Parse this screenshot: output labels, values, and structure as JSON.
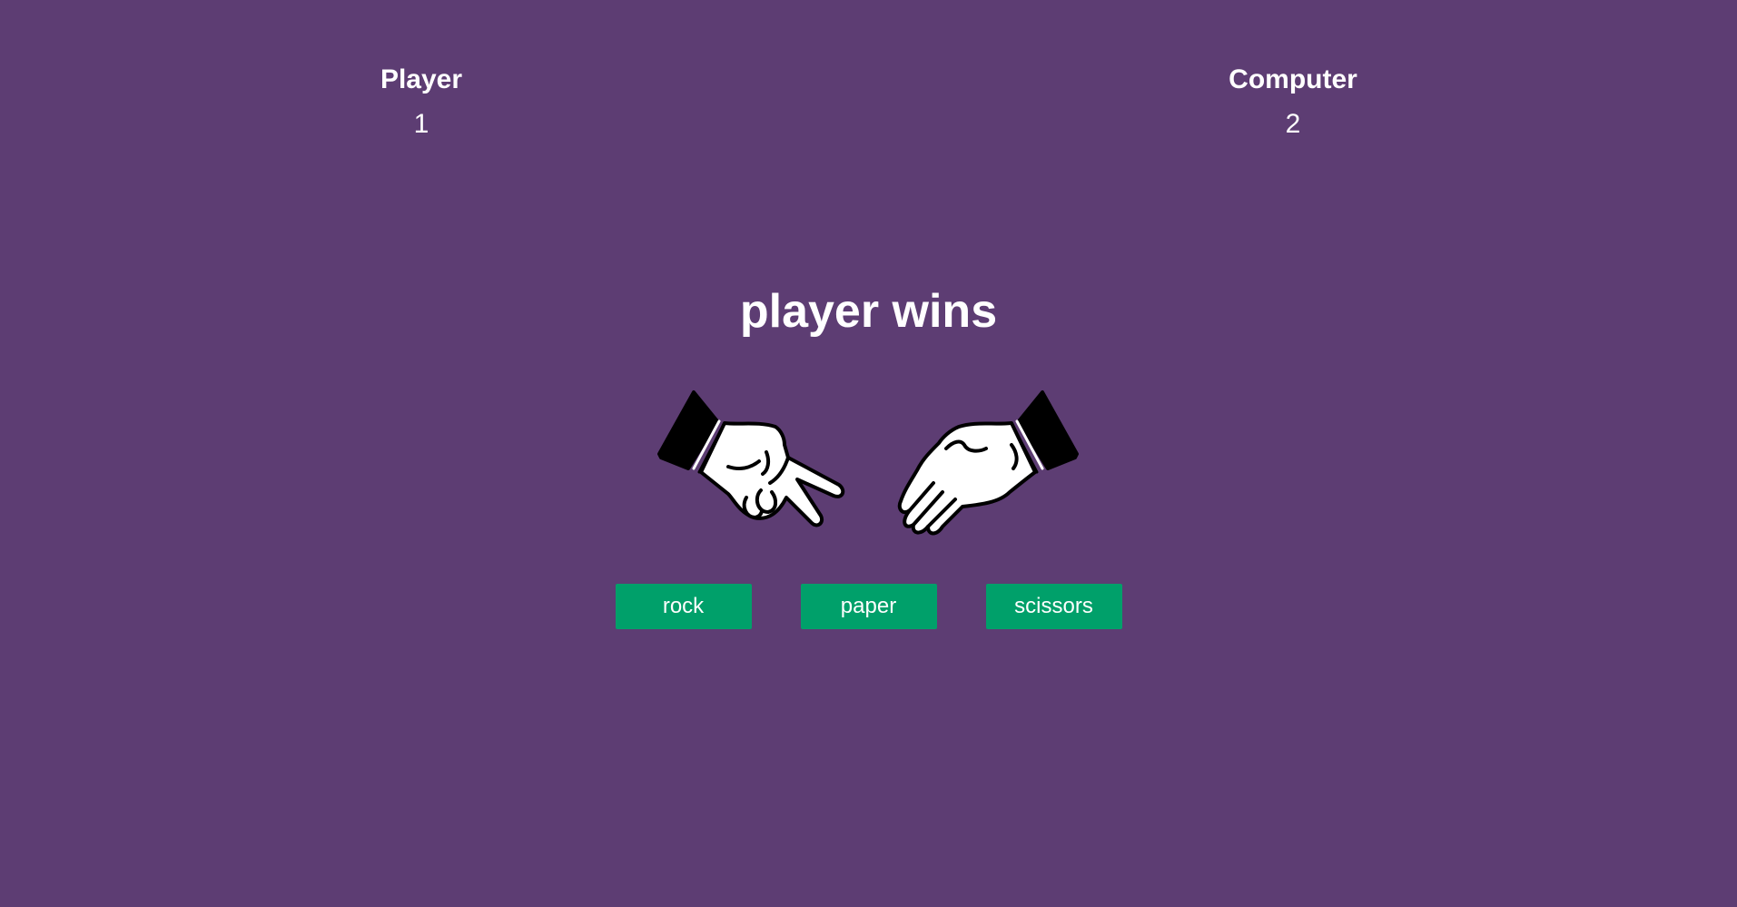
{
  "scoreboard": {
    "player": {
      "label": "Player",
      "score": "1"
    },
    "computer": {
      "label": "Computer",
      "score": "2"
    }
  },
  "result": "player wins",
  "hands": {
    "player": {
      "choice": "scissors",
      "icon": "scissors-hand-icon"
    },
    "computer": {
      "choice": "paper",
      "icon": "paper-hand-icon"
    }
  },
  "buttons": {
    "rock": "rock",
    "paper": "paper",
    "scissors": "scissors"
  },
  "colors": {
    "background": "#5d3d73",
    "button": "#00a06a",
    "text": "#ffffff"
  }
}
